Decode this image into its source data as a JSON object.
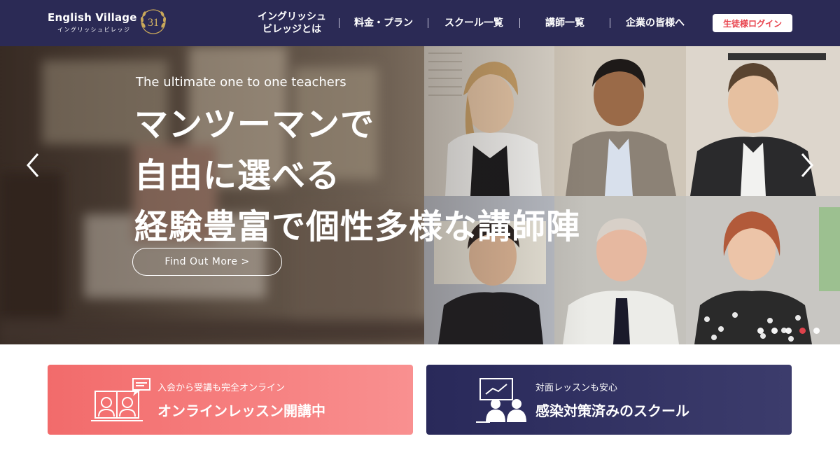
{
  "header": {
    "logo_text": "English Village",
    "logo_subtext": "イングリッシュビレッジ",
    "logo_badge_number": "31",
    "nav": [
      {
        "label": "イングリッシュ\nビレッジとは"
      },
      {
        "label": "料金・プラン"
      },
      {
        "label": "スクール一覧"
      },
      {
        "label": "講師一覧"
      },
      {
        "label": "企業の皆様へ"
      }
    ],
    "login_label": "生徒様ログイン"
  },
  "hero": {
    "tagline": "The ultimate one to one teachers",
    "headline_lines": [
      "マンツーマンで",
      "自由に選べる",
      "経験豊富で個性多様な講師陣"
    ],
    "cta_label": "Find Out More  >",
    "slide_count": 5,
    "active_slide": 4
  },
  "cards": {
    "online": {
      "subtitle": "入会から受講も完全オンライン",
      "title": "オンラインレッスン開講中"
    },
    "offline": {
      "subtitle": "対面レッスンも安心",
      "title": "感染対策済みのスクール"
    }
  },
  "colors": {
    "header_bg": "#2b2a55",
    "accent_red": "#e8434d",
    "card_online": "#f26b6b",
    "card_offline": "#29295a"
  }
}
